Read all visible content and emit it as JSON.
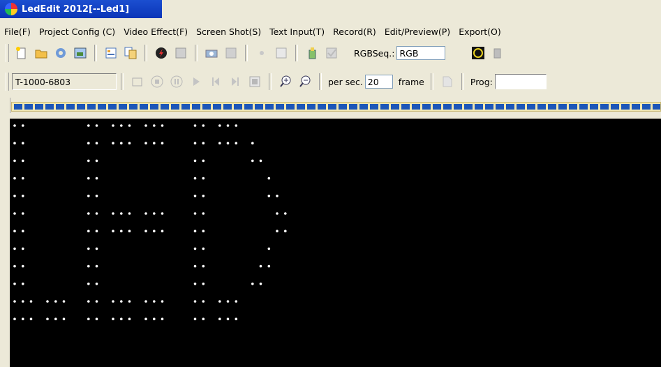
{
  "window": {
    "title": "LedEdit 2012[--Led1]"
  },
  "menu": [
    "File(F)",
    "Project Config (C)",
    "Video Effect(F)",
    "Screen Shot(S)",
    "Text Input(T)",
    "Record(R)",
    "Edit/Preview(P)",
    "Export(O)"
  ],
  "toolbar1": {
    "rgb_seq_label": "RGBSeq.:",
    "rgb_seq_value": "RGB"
  },
  "toolbar2": {
    "device_value": "T-1000-6803",
    "per_sec_label": "per sec.",
    "per_sec_value": "20",
    "frame_label": "frame",
    "prog_label": "Prog:",
    "prog_value": ""
  },
  "colors": {
    "led_on": "#ffffff",
    "screen_bg": "#000000",
    "ruler_cell": "#1c56b8",
    "title_bg": "#0b35b8"
  },
  "led_display": {
    "rows": [
      "XX       XX XXX XXX   XX XXX       ",
      "XX       XX XXX XXX   XX XXX X     ",
      "XX       XX           XX     XX    ",
      "XX       XX           XX       X   ",
      "XX       XX           XX       XX  ",
      "XX       XX XXX XXX   XX        XX ",
      "XX       XX XXX XXX   XX        XX ",
      "XX       XX           XX       X   ",
      "XX       XX           XX      XX   ",
      "XX       XX           XX     XX    ",
      "XXX XXX  XX XXX XXX   XX XXX       ",
      "XXX XXX  XX XXX XXX   XX XXX       "
    ]
  }
}
